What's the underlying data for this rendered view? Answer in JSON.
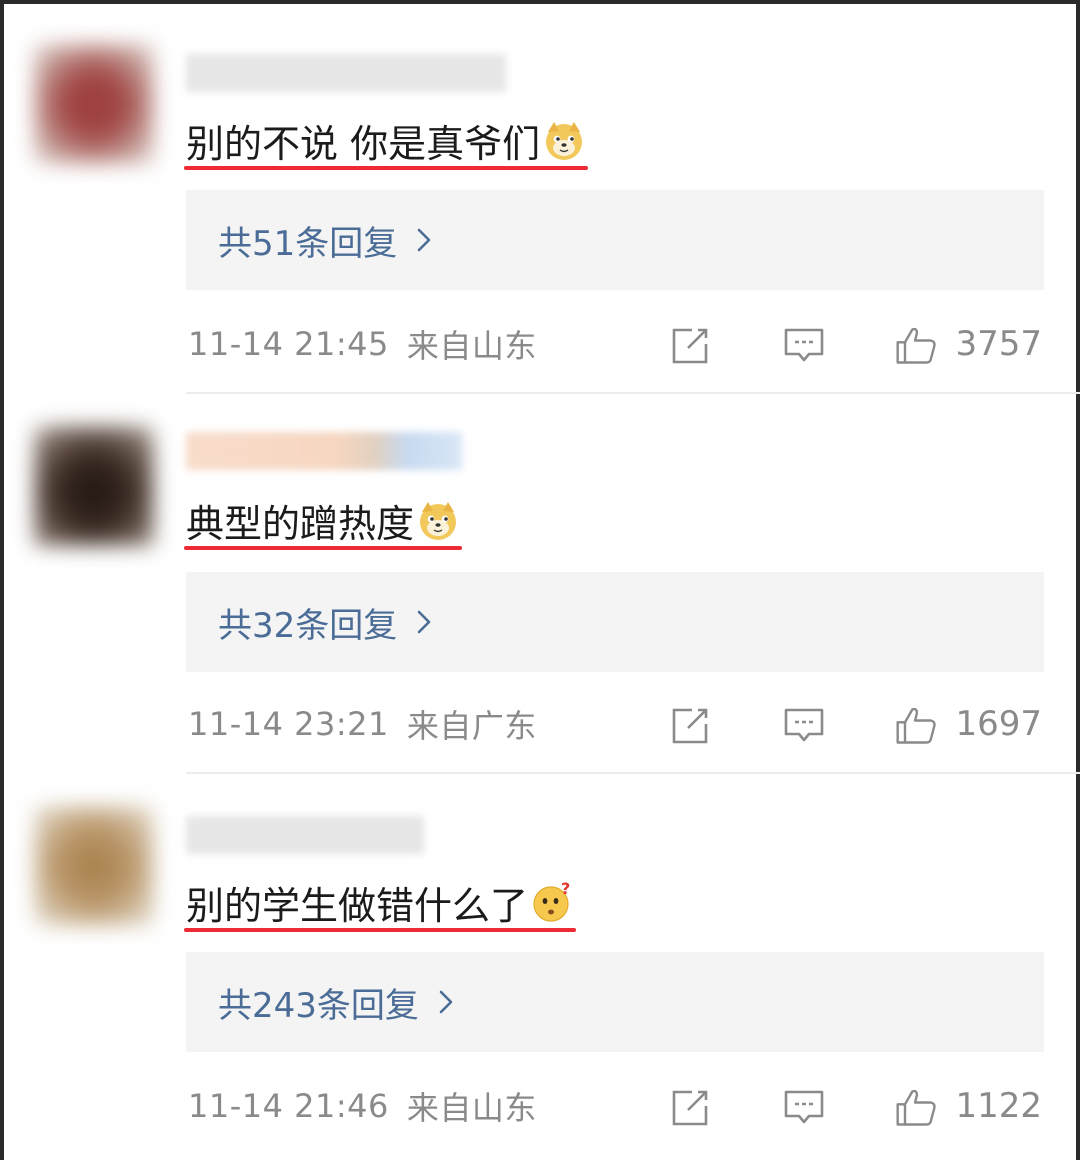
{
  "comments": [
    {
      "text": "别的不说 你是真爷们",
      "emoji": "doge-emoji",
      "replies_label": "共51条回复",
      "datetime": "11-14 21:45",
      "location": "来自山东",
      "likes": "3757",
      "avatar_color": "#9b3a3a"
    },
    {
      "text": "典型的蹭热度",
      "emoji": "doge-emoji",
      "replies_label": "共32条回复",
      "datetime": "11-14 23:21",
      "location": "来自广东",
      "likes": "1697",
      "avatar_color": "#3a2a22"
    },
    {
      "text": "别的学生做错什么了",
      "emoji": "question-face-emoji",
      "replies_label": "共243条回复",
      "datetime": "11-14 21:46",
      "location": "来自山东",
      "likes": "1122",
      "avatar_color": "#b89466"
    }
  ],
  "colors": {
    "underline": "#ee2b35",
    "reply_link": "#4a6c96",
    "meta_text": "#8a8a8a",
    "reply_bg": "#f4f4f4"
  }
}
